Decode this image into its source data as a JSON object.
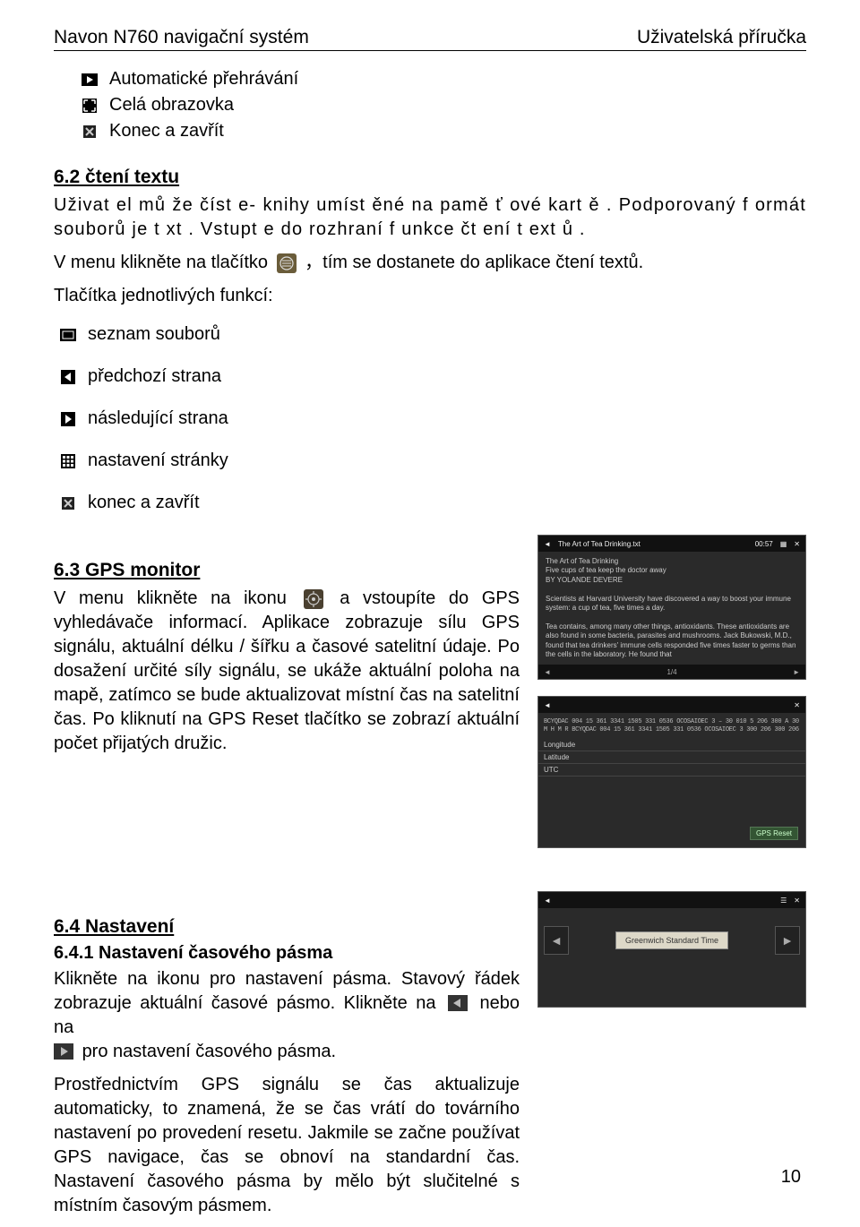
{
  "header": {
    "left": "Navon N760 navigační systém",
    "right": "Uživatelská příručka"
  },
  "top_icons": {
    "play": "Automatické přehrávání",
    "full": "Celá obrazovka",
    "close": "Konec a zavřít"
  },
  "s62": {
    "title": "6.2 čtení textu",
    "p1": "Uživat el mů že číst e- knihy umíst ěné na pamě ť ové kart ě . Podporovaný f ormát souborů je t xt . Vstupt e do rozhraní f unkce čt ení t ext ů .",
    "p2a": "V menu klikněte na tlačítko",
    "p2b": "，tím se dostanete do aplikace čtení textů.",
    "p3": "Tlačítka jednotlivých funkcí:",
    "funcs": {
      "list": "seznam souborů",
      "prev": "předchozí strana",
      "next": "následující strana",
      "page": "nastavení stránky",
      "close": "konec a zavřít"
    }
  },
  "s63": {
    "title": "6.3 GPS monitor",
    "p1a": "V menu klikněte na ikonu",
    "p1b": "a vstoupíte do GPS vyhledávače informací. Aplikace zobrazuje sílu GPS signálu, aktuální délku / šířku a časové satelitní údaje. Po dosažení určité síly signálu, se ukáže aktuální poloha na mapě, zatímco se bude aktualizovat místní čas na satelitní čas. Po kliknutí na GPS Reset tlačítko se zobrazí aktuální počet přijatých družic."
  },
  "shot1": {
    "title": "The Art of Tea Drinking.txt",
    "time": "00:57",
    "lines": "The Art of Tea Drinking\nFive cups of tea keep the doctor away\nBY YOLANDE DEVERE\n\nScientists at Harvard University have discovered a way to boost your immune system: a cup of tea, five times a day.\n\nTea contains, among many other things, antioxidants. These antioxidants are also found in some bacteria, parasites and mushrooms. Jack Bukowski, M.D., found that tea drinkers' immune cells responded five times faster to germs than the cells in the laboratory. He found that",
    "page": "1/4"
  },
  "shot2": {
    "noise": "BCYQDAC 004 15 361 3341 1505 331 0536 OCOSAIOEC 3 – 30 010 5 206 300\nA 30 M H M R\nBCYQDAC 004 15 361 3341 1505 331 0536 OCOSAIOEC 3 300 206 300 206",
    "rows": {
      "lon": "Longitude",
      "lat": "Latitude",
      "utc": "UTC"
    },
    "btn": "GPS Reset"
  },
  "s64": {
    "title": "6.4 Nastavení",
    "sub": "6.4.1 Nastavení časového pásma",
    "p1a": "Klikněte na ikonu pro nastavení pásma. Stavový řádek zobrazuje aktuální časové pásmo. Klikněte na",
    "p1b": "nebo na",
    "p1c": "pro nastavení časového pásma.",
    "p2": "Prostřednictvím GPS signálu se čas aktualizuje automaticky, to znamená, že se čas vrátí do továrního nastavení po provedení resetu. Jakmile se začne používat GPS navigace, čas se obnoví na standardní čas. Nastavení časového pásma by mělo být slučitelné s místním časovým pásmem."
  },
  "shot3": {
    "label": "Greenwich Standard Time"
  },
  "page_num": "10"
}
